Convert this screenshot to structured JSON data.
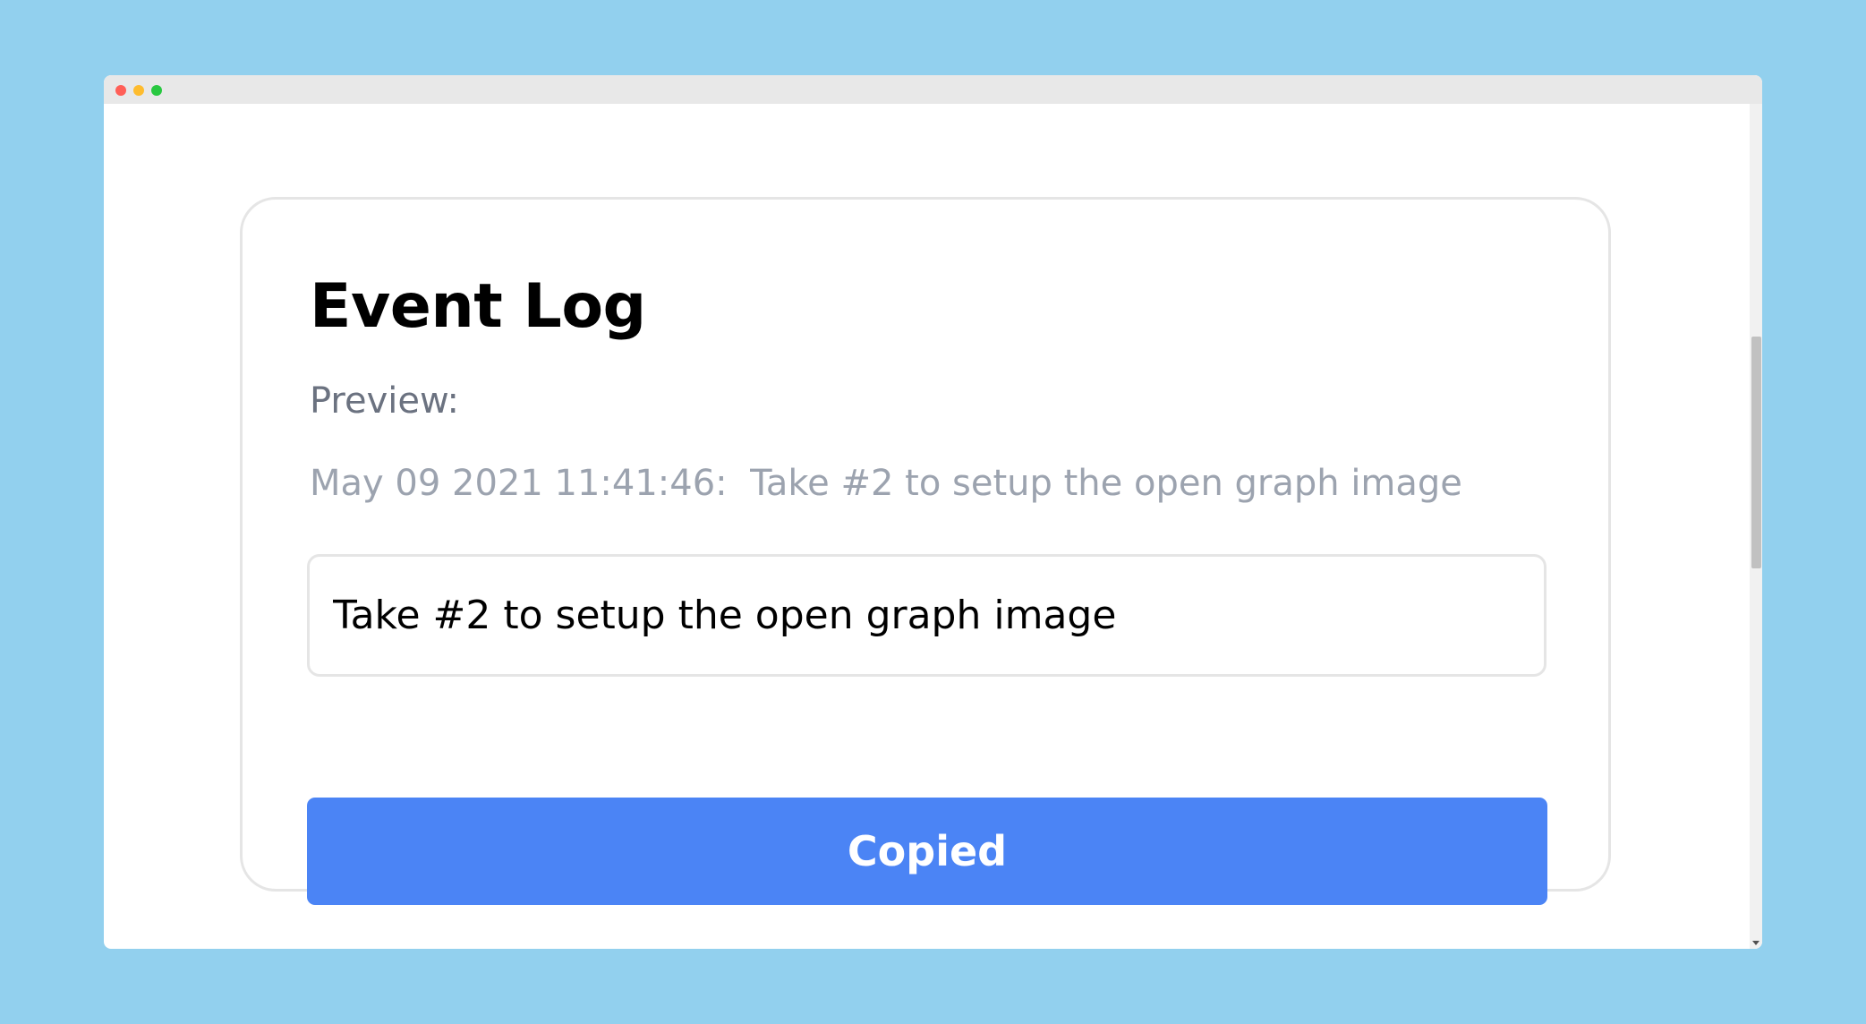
{
  "window": {
    "controls": [
      "close",
      "minimize",
      "maximize"
    ]
  },
  "card": {
    "title": "Event Log",
    "preview_label": "Preview:",
    "preview_text": "May 09 2021 11:41:46:  Take #2 to setup the open graph image",
    "input_value": "Take #2 to setup the open graph image",
    "button_label": "Copied"
  },
  "colors": {
    "background": "#92d0ee",
    "button": "#4b84f5",
    "preview_label": "#6b7280",
    "preview_text": "#9ca3af"
  }
}
